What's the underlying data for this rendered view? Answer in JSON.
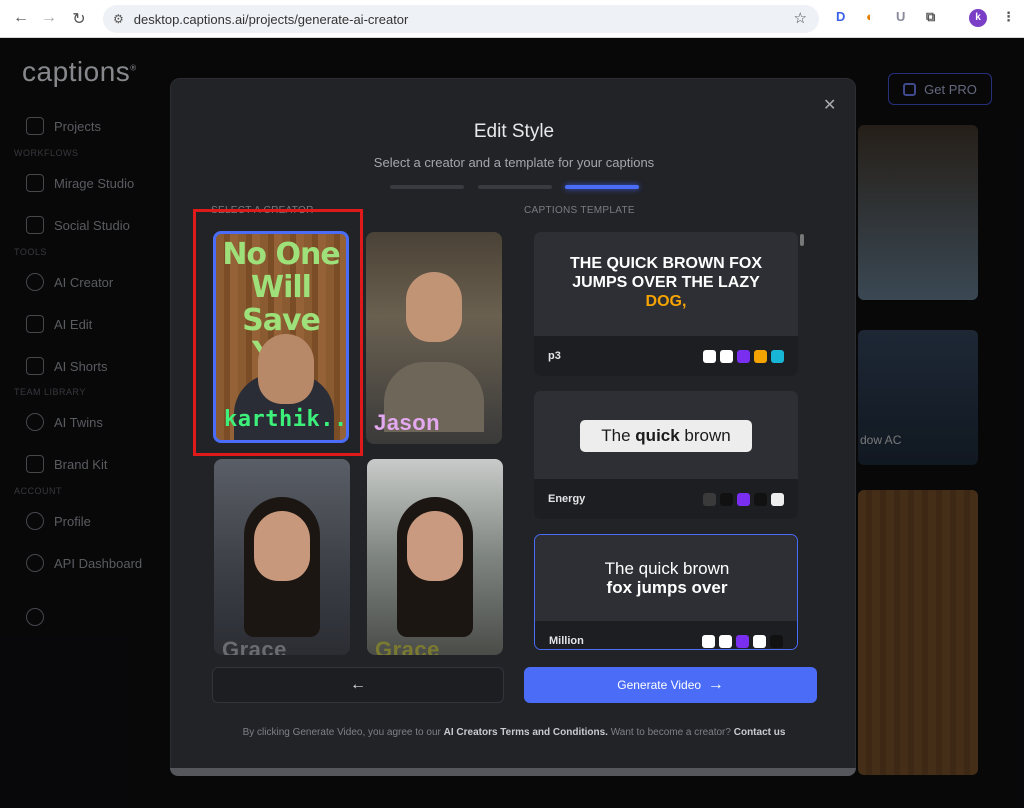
{
  "browser": {
    "url": "desktop.captions.ai/projects/generate-ai-creator",
    "profile_initial": "k"
  },
  "app": {
    "logo": "captions",
    "get_pro": "Get PRO",
    "sidebar": {
      "projects": "Projects",
      "workflows_head": "WORKFLOWS",
      "mirage": "Mirage Studio",
      "social": "Social Studio",
      "tools_head": "TOOLS",
      "ai_creator": "AI Creator",
      "ai_edit": "AI Edit",
      "ai_shorts": "AI Shorts",
      "team_head": "TEAM LIBRARY",
      "ai_twins": "AI Twins",
      "brand_kit": "Brand Kit",
      "account_head": "ACCOUNT",
      "profile": "Profile",
      "api": "API Dashboard"
    },
    "bg_card_label": "dow AC"
  },
  "modal": {
    "title": "Edit Style",
    "subtitle": "Select a creator and a template for your captions",
    "steps_active_index": 2,
    "select_creator_label": "SELECT A CREATOR",
    "captions_template_label": "CAPTIONS TEMPLATE",
    "creators": [
      {
        "name": "karthik...",
        "overlay": "No One Will Save You",
        "selected": true
      },
      {
        "name": "Jason"
      },
      {
        "name": "Grace"
      },
      {
        "name": "Grace"
      }
    ],
    "templates": [
      {
        "name": "p3",
        "line1": "THE QUICK BROWN FOX",
        "line2": "JUMPS OVER THE LAZY",
        "line3": "DOG,",
        "swatches": [
          "#ffffff",
          "#ffffff",
          "#7a2ff0",
          "#f5a300",
          "#17b6d6"
        ]
      },
      {
        "name": "Energy",
        "text_a": "The ",
        "text_b": "quick",
        "text_c": " brown",
        "swatches": [
          "#3a3a3a",
          "#111111",
          "#7a2ff0",
          "#111111",
          "#eeeeee"
        ]
      },
      {
        "name": "Million",
        "line1": "The quick brown",
        "line2": "fox jumps over",
        "swatches": [
          "#ffffff",
          "#ffffff",
          "#7a2ff0",
          "#ffffff",
          "#111111"
        ]
      }
    ],
    "back_arrow": "←",
    "generate_label": "Generate Video",
    "generate_arrow": "→",
    "terms_prefix": "By clicking Generate Video, you agree to our ",
    "terms_link": "AI Creators Terms and Conditions.",
    "terms_mid": " Want to become a creator? ",
    "contact_link": "Contact us"
  },
  "colors": {
    "accent": "#4a6cf7",
    "highlight": "#e01a1a",
    "p3_orange": "#f5a300"
  }
}
